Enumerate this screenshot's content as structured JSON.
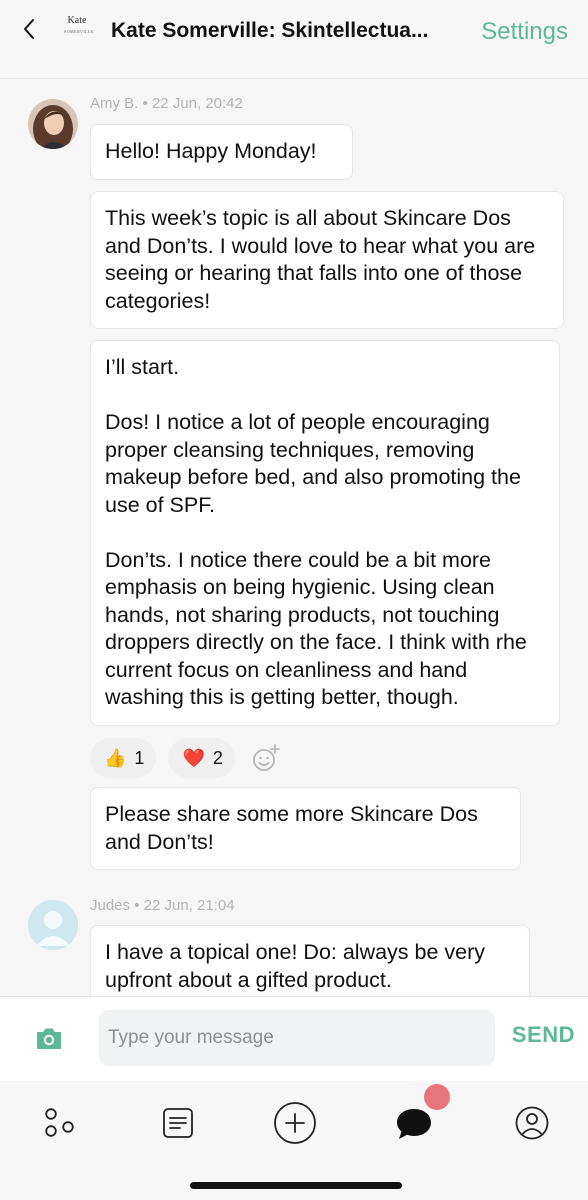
{
  "header": {
    "group_logo_text": "Kate",
    "group_logo_sub": "SOMERVILLE",
    "title": "Kate Somerville: Skintellectua...",
    "settings_label": "Settings"
  },
  "messages": [
    {
      "author": "Amy B.",
      "timestamp": "22 Jun, 20:42",
      "bubbles": [
        {
          "paragraphs": [
            "Hello! Happy Monday!"
          ]
        },
        {
          "paragraphs": [
            "This week’s topic is all about Skincare Dos and Don’ts. I would love to hear what you are seeing or hearing that falls into one of those categories!"
          ]
        },
        {
          "paragraphs": [
            "I’ll start.",
            "Dos! I notice a lot of people encouraging proper cleansing techniques, removing makeup before bed, and also promoting the use of SPF.",
            "Don’ts. I notice there could be a bit more emphasis on being hygienic. Using clean hands, not sharing products, not touching droppers directly on the face. I think with rhe current focus on cleanliness and hand washing this is getting better, though."
          ]
        }
      ],
      "reactions": [
        {
          "emoji": "👍",
          "count": "1"
        },
        {
          "emoji": "❤️",
          "count": "2"
        }
      ],
      "followup": "Please share some more Skincare Dos and Don’ts!"
    },
    {
      "author": "Judes",
      "timestamp": "22 Jun, 21:04",
      "bubbles": [
        {
          "paragraphs": [
            "I have a topical one! Do: always be very upfront about a gifted product."
          ]
        }
      ]
    }
  ],
  "composer": {
    "placeholder": "Type your message",
    "value": "",
    "send_label": "SEND"
  },
  "tabbar": {
    "items": [
      "explore-icon",
      "feed-icon",
      "create-icon",
      "chat-icon",
      "profile-icon"
    ],
    "active": "chat-icon",
    "badge_color": "#e8747c"
  },
  "colors": {
    "accent": "#5db897",
    "meta": "#b4b4b4"
  }
}
